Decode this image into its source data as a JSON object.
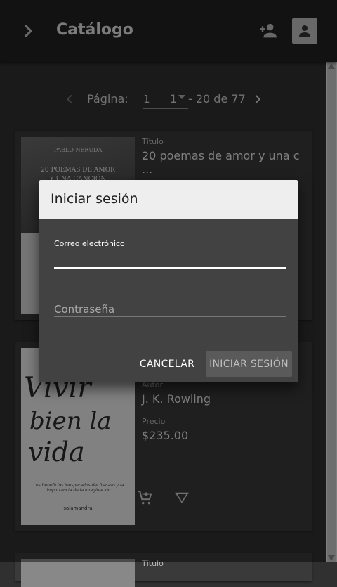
{
  "header": {
    "title": "Catálogo",
    "menu_icon": "chevron-right-icon",
    "add_user_icon": "person-add-icon",
    "account_icon": "account-icon"
  },
  "pager": {
    "label": "Página:",
    "page_value": "1",
    "range_start": "1",
    "range_rest": "- 20 de 77"
  },
  "books": [
    {
      "title_label": "Título",
      "title_value": "20 poemas de amor y una c",
      "title_more": "...",
      "cover_text": [
        "PABLO NERUDA",
        "20 POEMAS DE AMOR",
        "Y UNA CANCIÓN"
      ]
    },
    {
      "author_label": "Autor",
      "author_value": "J. K. Rowling",
      "price_label": "Precio",
      "price_value": "$235.00",
      "cover_text": [
        "Vivir",
        "bien la",
        "vida",
        "Los beneficios inesperados del fracaso y la importancia de la imaginación",
        "salamandra"
      ]
    },
    {
      "title_label": "Título"
    }
  ],
  "dialog": {
    "title": "Iniciar sesión",
    "email_label": "Correo electrónico",
    "password_placeholder": "Contraseña",
    "cancel_label": "CANCELAR",
    "submit_label": "INICIAR SESIÓN"
  }
}
